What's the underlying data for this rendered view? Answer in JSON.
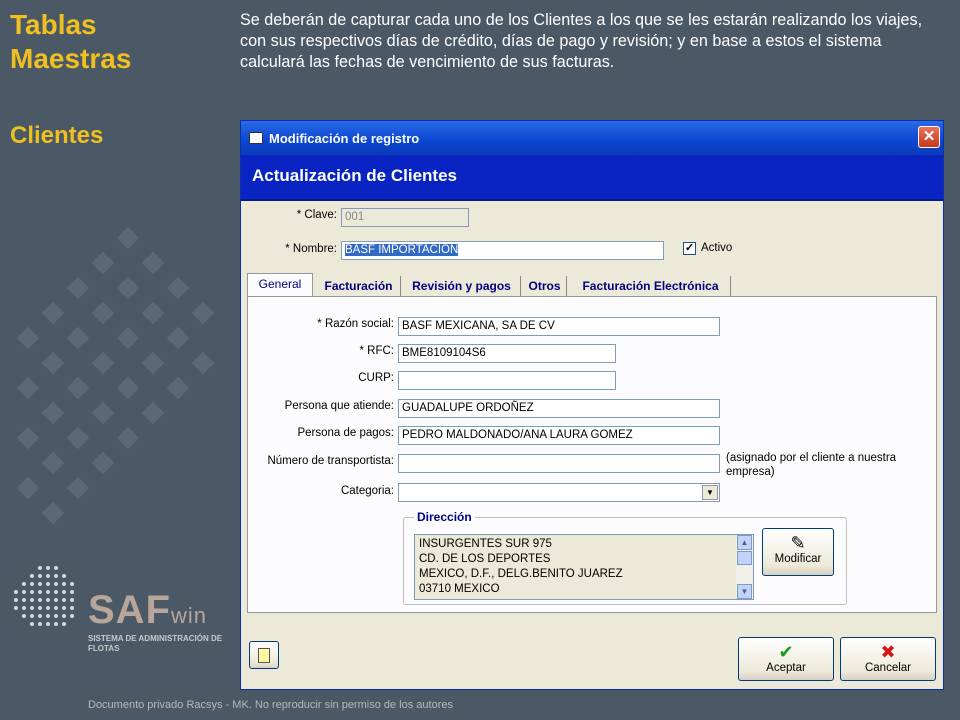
{
  "slide": {
    "title": "Tablas Maestras",
    "subtitle": "Clientes",
    "description": "Se deberán de capturar cada uno de los Clientes a los que se les estarán realizando los viajes, con sus respectivos días de crédito, días de pago y revisión; y en base a estos el sistema calculará las fechas de vencimiento de sus facturas.",
    "logo": {
      "word_main": "SAF",
      "word_suffix": "win",
      "tagline": "SISTEMA DE ADMINISTRACIÓN DE FLOTAS"
    },
    "footer": "Documento privado Racsys - MK. No reproducir sin permiso de los autores"
  },
  "window": {
    "title": "Modificación de registro",
    "header": "Actualización de Clientes",
    "clave_label": "* Clave:",
    "clave_value": "001",
    "nombre_label": "* Nombre:",
    "nombre_value": "BASF IMPORTACION",
    "activo_label": "Activo",
    "activo_checked": true,
    "tabs": [
      "General",
      "Facturación",
      "Revisión y pagos",
      "Otros",
      "Facturación Electrónica"
    ],
    "active_tab": "General",
    "general": {
      "razon_label": "* Razón social:",
      "razon_value": "BASF MEXICANA, SA DE CV",
      "rfc_label": "* RFC:",
      "rfc_value": "BME8109104S6",
      "curp_label": "CURP:",
      "curp_value": "",
      "atiende_label": "Persona que atiende:",
      "atiende_value": "GUADALUPE ORDOÑEZ",
      "pagos_label": "Persona de pagos:",
      "pagos_value": "PEDRO MALDONADO/ANA LAURA GOMEZ",
      "transp_label": "Número de transportista:",
      "transp_value": "",
      "transp_note": "(asignado por el cliente a nuestra empresa)",
      "categoria_label": "Categoria:",
      "categoria_value": ""
    },
    "direccion": {
      "legend": "Dirección",
      "lines": [
        "INSURGENTES SUR 975",
        "CD. DE LOS DEPORTES",
        "MEXICO, D.F., DELG.BENITO JUAREZ",
        "03710 MEXICO"
      ],
      "modificar_label": "Modificar"
    },
    "buttons": {
      "aceptar": "Aceptar",
      "cancelar": "Cancelar"
    }
  },
  "colors": {
    "title_yellow": "#f0c020",
    "header_blue": "#0a24c4",
    "background": "#4b5866"
  }
}
